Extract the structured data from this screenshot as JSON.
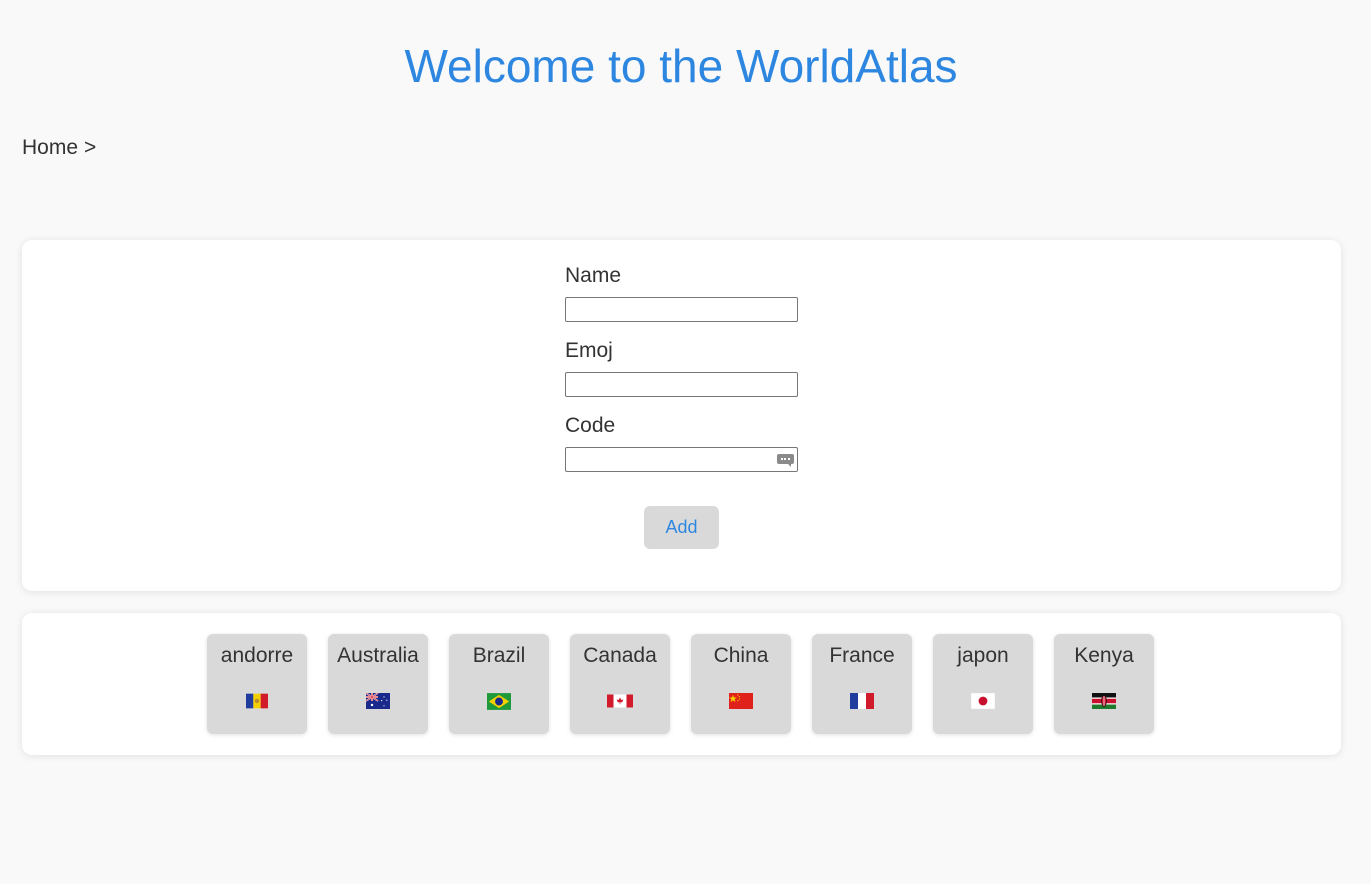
{
  "header": {
    "title": "Welcome to the WorldAtlas"
  },
  "breadcrumb": {
    "home": "Home",
    "separator": ">"
  },
  "form": {
    "name_label": "Name",
    "name_value": "",
    "emoji_label": "Emoj",
    "emoji_value": "",
    "code_label": "Code",
    "code_value": "",
    "add_label": "Add"
  },
  "countries": [
    {
      "name": "andorre",
      "flag": "🇦🇩",
      "flag_icon": "flag-andorra"
    },
    {
      "name": "Australia",
      "flag": "🇦🇺",
      "flag_icon": "flag-australia"
    },
    {
      "name": "Brazil",
      "flag": "🇧🇷",
      "flag_icon": "flag-brazil"
    },
    {
      "name": "Canada",
      "flag": "🇨🇦",
      "flag_icon": "flag-canada"
    },
    {
      "name": "China",
      "flag": "🇨🇳",
      "flag_icon": "flag-china"
    },
    {
      "name": "France",
      "flag": "🇫🇷",
      "flag_icon": "flag-france"
    },
    {
      "name": "japon",
      "flag": "🇯🇵",
      "flag_icon": "flag-japan"
    },
    {
      "name": "Kenya",
      "flag": "🇰🇪",
      "flag_icon": "flag-kenya"
    }
  ],
  "colors": {
    "accent": "#2d87e0",
    "tile": "#d9d9d9",
    "background": "#f9f9f9"
  }
}
